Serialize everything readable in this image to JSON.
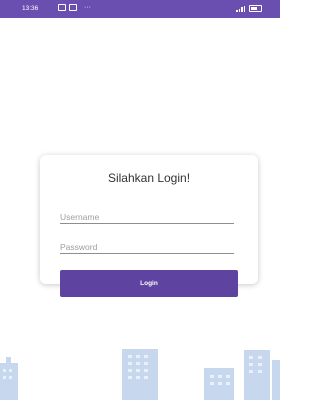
{
  "status_bar": {
    "time": "13:36",
    "left_icons": [
      "message-icon",
      "image-icon"
    ],
    "overflow": "···",
    "right_icons": [
      "signal-icon",
      "battery-icon"
    ],
    "color": "#6a4fb0"
  },
  "login": {
    "title": "Silahkan Login!",
    "username_placeholder": "Username",
    "username_value": "",
    "password_placeholder": "Password",
    "password_value": "",
    "button_label": "Login",
    "button_color": "#5f43a0"
  },
  "background": {
    "illustration": "city-buildings",
    "building_color": "#c7d8ee"
  }
}
